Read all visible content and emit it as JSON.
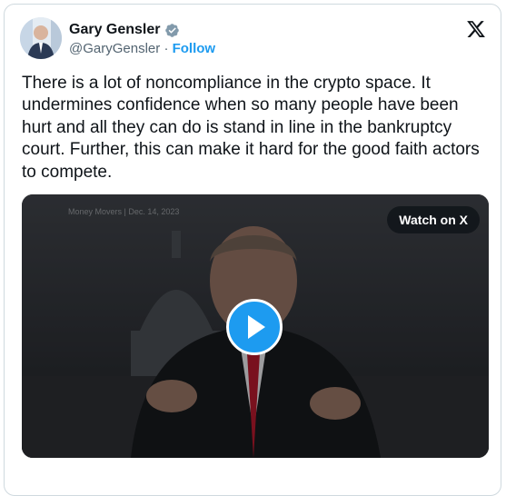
{
  "tweet": {
    "author_name": "Gary Gensler",
    "handle": "@GaryGensler",
    "separator": "·",
    "follow_label": "Follow",
    "text": "There is a lot of noncompliance in the crypto space. It undermines confidence when so many people have been hurt and all they can do is stand in line in the bankruptcy court. Further, this can make it hard for the good faith actors to compete."
  },
  "video": {
    "watch_label": "Watch on X",
    "caption": "Money Movers | Dec. 14, 2023"
  },
  "colors": {
    "accent": "#1d9bf0",
    "text": "#0f1419",
    "muted": "#536471",
    "border": "#cfd9de"
  },
  "icons": [
    "verified-badge-icon",
    "x-logo-icon",
    "play-icon"
  ]
}
